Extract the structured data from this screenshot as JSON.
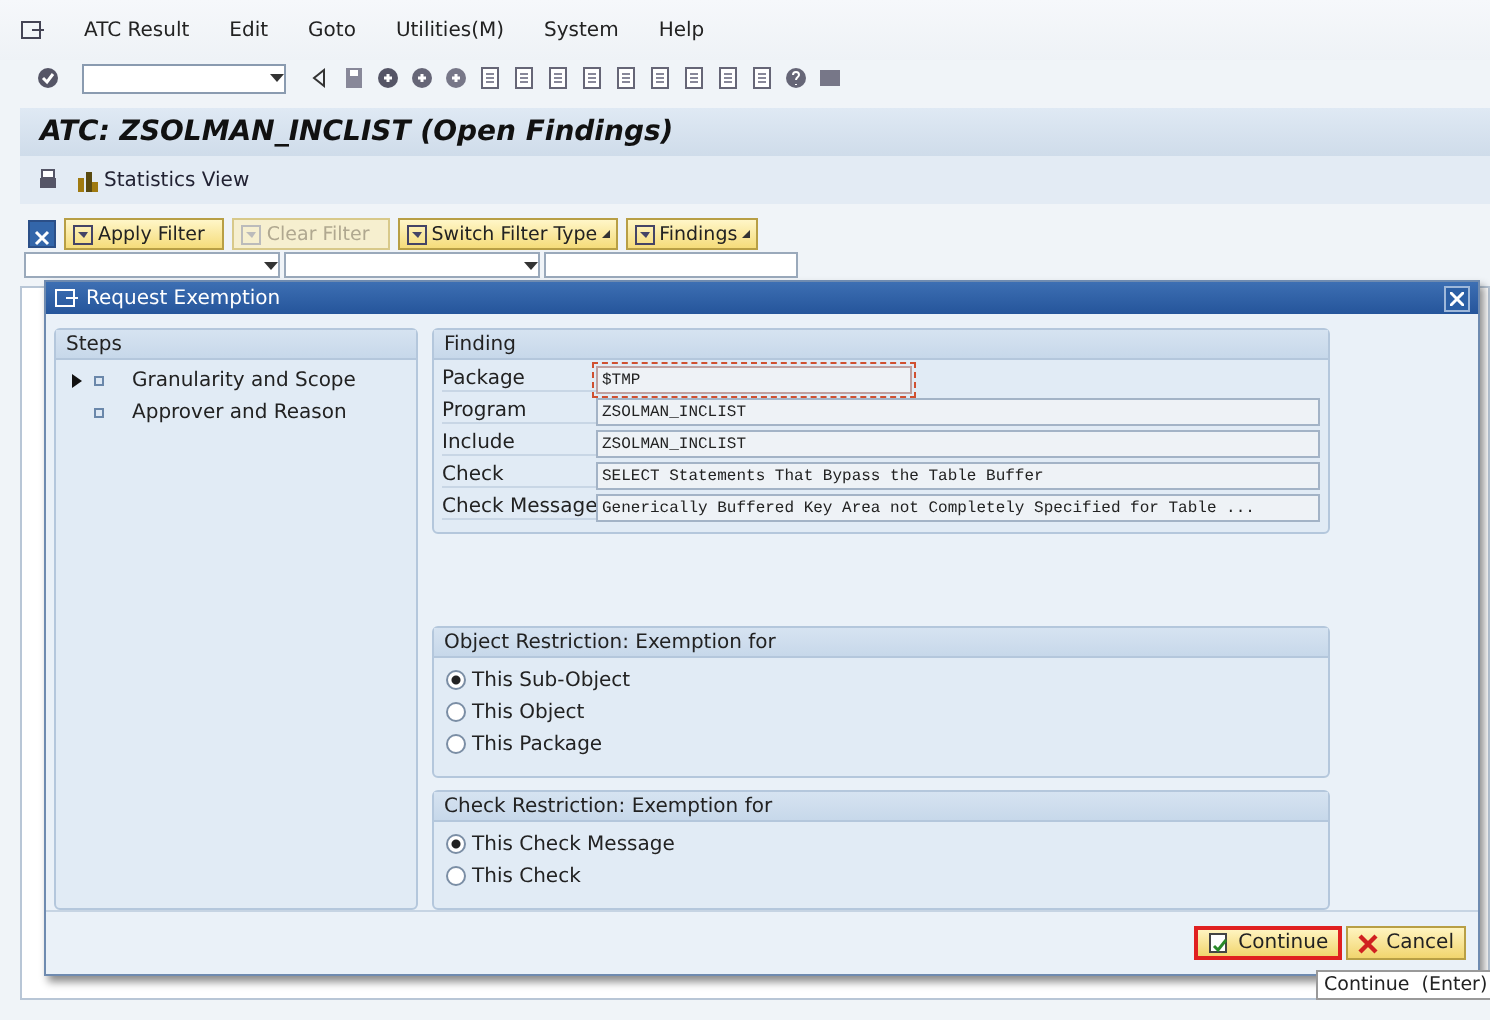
{
  "menu_bar": {
    "items": [
      "ATC Result",
      "Edit",
      "Goto",
      "Utilities(M)",
      "System",
      "Help"
    ]
  },
  "title": "ATC:  ZSOLMAN_INCLIST (Open Findings)",
  "app_toolbar": {
    "buttons": [
      {
        "label": "Statistics View"
      }
    ]
  },
  "filter_toolbar": {
    "buttons": [
      {
        "label": "Apply Filter",
        "disabled": false,
        "dropdown": false
      },
      {
        "label": "Clear Filter",
        "disabled": true,
        "dropdown": false
      },
      {
        "label": "Switch Filter Type",
        "disabled": false,
        "dropdown": true
      },
      {
        "label": "Findings",
        "disabled": false,
        "dropdown": true
      }
    ]
  },
  "dialog": {
    "title": "Request Exemption",
    "steps": {
      "title": "Steps",
      "items": [
        {
          "label": "Granularity and Scope",
          "current": true
        },
        {
          "label": "Approver and Reason",
          "current": false
        }
      ]
    },
    "finding": {
      "title": "Finding",
      "fields": [
        {
          "label": "Package",
          "value": "$TMP",
          "kind": "short",
          "focused": true
        },
        {
          "label": "Program",
          "value": "ZSOLMAN_INCLIST",
          "kind": "long",
          "focused": false
        },
        {
          "label": "Include",
          "value": "ZSOLMAN_INCLIST",
          "kind": "long",
          "focused": false
        },
        {
          "label": "Check",
          "value": "SELECT Statements That Bypass the Table Buffer",
          "kind": "long",
          "focused": false
        },
        {
          "label": "Check Message",
          "value": "Generically Buffered Key Area not Completely Specified for Table ...",
          "kind": "long",
          "focused": false
        }
      ]
    },
    "object_restriction": {
      "title": "Object Restriction: Exemption for",
      "options": [
        {
          "label": "This Sub-Object",
          "selected": true
        },
        {
          "label": "This Object",
          "selected": false
        },
        {
          "label": "This Package",
          "selected": false
        }
      ]
    },
    "check_restriction": {
      "title": "Check Restriction: Exemption for",
      "options": [
        {
          "label": "This Check Message",
          "selected": true
        },
        {
          "label": "This Check",
          "selected": false
        }
      ]
    },
    "buttons": [
      {
        "label": "Continue",
        "kind": "continue",
        "focused": true
      },
      {
        "label": "Cancel",
        "kind": "cancel",
        "focused": false
      }
    ]
  },
  "tooltip": "Continue  (Enter)"
}
